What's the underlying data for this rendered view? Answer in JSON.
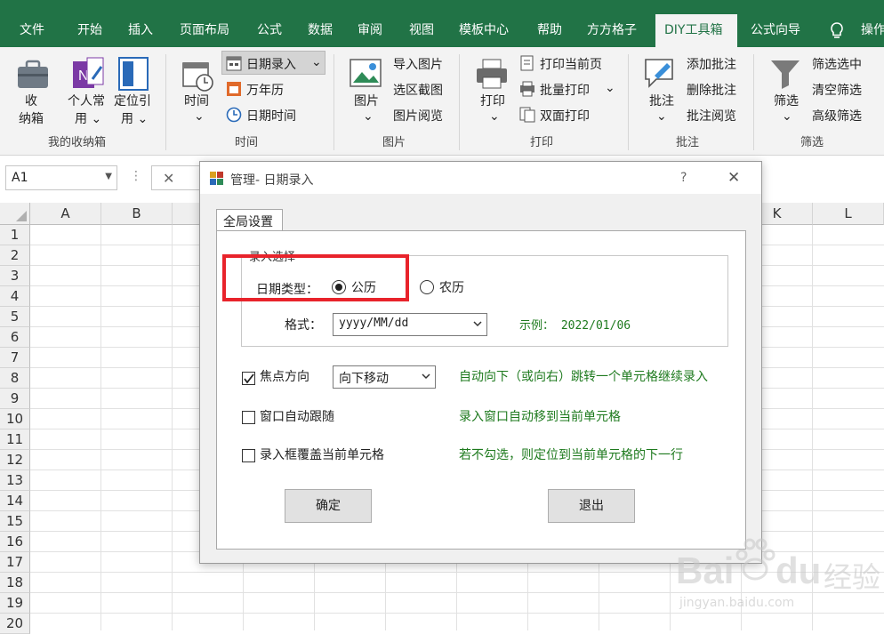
{
  "tabs": [
    "文件",
    "开始",
    "插入",
    "页面布局",
    "公式",
    "数据",
    "审阅",
    "视图",
    "模板中心",
    "帮助",
    "方方格子",
    "DIY工具箱",
    "公式向导",
    "操作"
  ],
  "active_tab": "DIY工具箱",
  "ribbon": {
    "groups": {
      "storage": "我的收纳箱",
      "time": "时间",
      "image": "图片",
      "print": "打印",
      "comment": "批注",
      "filter": "筛选"
    },
    "storage": {
      "box_l1": "收",
      "box_l2": "纳箱",
      "personal_l1": "个人常",
      "personal_l2": "用 ⌄",
      "locate_l1": "定位引",
      "locate_l2": "用 ⌄"
    },
    "time": {
      "time_btn": "时间",
      "date_entry": "日期录入",
      "calendar": "万年历",
      "datetime": "日期时间"
    },
    "image": {
      "image_btn": "图片",
      "import": "导入图片",
      "area_shot": "选区截图",
      "browse": "图片阅览"
    },
    "print": {
      "print_btn": "打印",
      "print_current": "打印当前页",
      "batch_print": "批量打印",
      "duplex": "双面打印"
    },
    "comment": {
      "comment_btn": "批注",
      "add": "添加批注",
      "delete": "删除批注",
      "browse": "批注阅览"
    },
    "filter": {
      "filter_btn": "筛选",
      "select": "筛选选中",
      "clear": "清空筛选",
      "advanced": "高级筛选"
    }
  },
  "formula_bar": {
    "name_box": "A1",
    "cancel_glyph": "✕"
  },
  "columns": [
    "A",
    "B",
    "K",
    "L"
  ],
  "rows": [
    "1",
    "2",
    "3",
    "4",
    "5",
    "6",
    "7",
    "8",
    "9",
    "10",
    "11",
    "12",
    "13",
    "14",
    "15",
    "16",
    "17",
    "18",
    "19",
    "20"
  ],
  "dialog": {
    "title": "管理- 日期录入",
    "help": "?",
    "close": "✕",
    "tab": "全局设置",
    "section_label": "录入选择",
    "date_type_label": "日期类型：",
    "gregorian": "公历",
    "lunar": "农历",
    "format_label": "格式：",
    "format_value": "yyyy/MM/dd",
    "example": "示例： 2022/01/06",
    "focus_direction": "焦点方向",
    "focus_value": "向下移动",
    "focus_desc": "自动向下（或向右）跳转一个单元格继续录入",
    "follow": "窗口自动跟随",
    "follow_desc": "录入窗口自动移到当前单元格",
    "cover": "录入框覆盖当前单元格",
    "cover_desc": "若不勾选，则定位到当前单元格的下一行",
    "ok": "确定",
    "exit": "退出",
    "checked_focus": true,
    "checked_follow": false,
    "checked_cover": false,
    "selected_date_type": "公历"
  },
  "watermark": {
    "brand_en": "Bai",
    "brand_du": "du",
    "brand_cn": "经验",
    "url": "jingyan.baidu.com"
  },
  "colors": {
    "excel_green": "#217346",
    "highlight_red": "#e8232b",
    "desc_green": "#1e7a1e"
  }
}
